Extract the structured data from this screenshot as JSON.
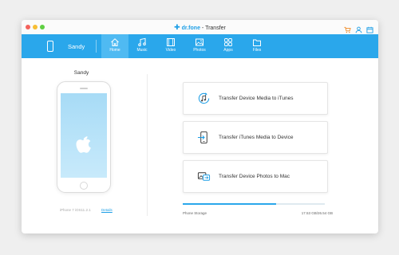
{
  "window": {
    "brand_name": "dr.fone",
    "brand_section": "- Transfer"
  },
  "colors": {
    "accent": "#2aa7eb",
    "nav_active": "#4fbaf2",
    "link": "#1c9ee6"
  },
  "titlebar_icons": [
    "cart-icon",
    "user-icon",
    "calendar-icon"
  ],
  "device": {
    "name": "Sandy",
    "model_info": "iPhone 7 iOS11.2.1",
    "details_label": "Details"
  },
  "nav": {
    "items": [
      {
        "label": "Home",
        "icon": "home-icon"
      },
      {
        "label": "Music",
        "icon": "music-icon"
      },
      {
        "label": "Video",
        "icon": "video-icon"
      },
      {
        "label": "Photos",
        "icon": "photos-icon"
      },
      {
        "label": "Apps",
        "icon": "apps-icon"
      },
      {
        "label": "Files",
        "icon": "files-icon"
      }
    ],
    "active": "Home"
  },
  "actions": [
    {
      "label": "Transfer Device Media to iTunes",
      "icon": "itunes-icon"
    },
    {
      "label": "Transfer iTunes Media to Device",
      "icon": "to-device-icon"
    },
    {
      "label": "Transfer Device Photos to Mac",
      "icon": "to-mac-icon"
    }
  ],
  "storage": {
    "label": "Phone Storage",
    "used": "17.53 GB",
    "total": "26.54 GB",
    "display": "17.53 GB/26.54 GB",
    "used_fraction": 0.66
  }
}
